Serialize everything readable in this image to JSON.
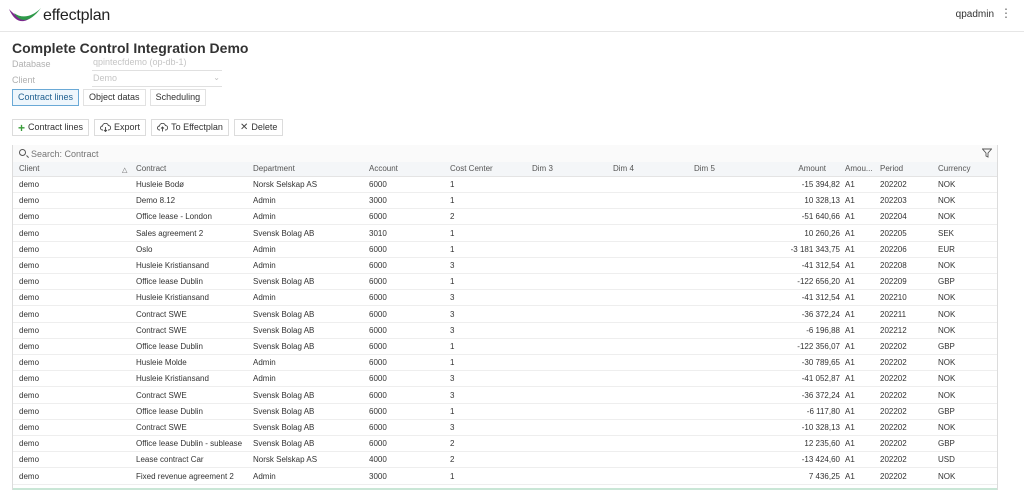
{
  "app": {
    "logo_text": "effectplan",
    "user": "qpadmin",
    "colors": {
      "accent": "#6aa9d6",
      "logo_purple": "#7a2a8c",
      "logo_green": "#2f9a4a"
    }
  },
  "page": {
    "title": "Complete Control Integration Demo",
    "database_label": "Database",
    "database_value": "qpintecfdemo (op-db-1)",
    "client_label": "Client",
    "client_value": "Demo"
  },
  "tabs": [
    {
      "label": "Contract lines",
      "active": true
    },
    {
      "label": "Object datas",
      "active": false
    },
    {
      "label": "Scheduling",
      "active": false
    }
  ],
  "toolbar": {
    "add_label": "Contract lines",
    "export_label": "Export",
    "to_effectplan_label": "To Effectplan",
    "delete_label": "Delete"
  },
  "grid": {
    "search_placeholder": "Search: Contract",
    "columns": [
      "Client",
      "Contract",
      "Department",
      "Account",
      "Cost Center",
      "Dim 3",
      "Dim 4",
      "Dim 5",
      "Amount",
      "Amou...",
      "Period",
      "Currency"
    ],
    "rows": [
      [
        "demo",
        "Husleie Bodø",
        "Norsk Selskap AS",
        "6000",
        "1",
        "",
        "",
        "",
        "-15 394,82",
        "A1",
        "202202",
        "NOK"
      ],
      [
        "demo",
        "Demo 8.12",
        "Admin",
        "3000",
        "1",
        "",
        "",
        "",
        "10 328,13",
        "A1",
        "202203",
        "NOK"
      ],
      [
        "demo",
        "Office lease - London",
        "Admin",
        "6000",
        "2",
        "",
        "",
        "",
        "-51 640,66",
        "A1",
        "202204",
        "NOK"
      ],
      [
        "demo",
        "Sales agreement 2",
        "Svensk Bolag AB",
        "3010",
        "1",
        "",
        "",
        "",
        "10 260,26",
        "A1",
        "202205",
        "SEK"
      ],
      [
        "demo",
        "Oslo",
        "Admin",
        "6000",
        "1",
        "",
        "",
        "",
        "-3 181 343,75",
        "A1",
        "202206",
        "EUR"
      ],
      [
        "demo",
        "Husleie Kristiansand",
        "Admin",
        "6000",
        "3",
        "",
        "",
        "",
        "-41 312,54",
        "A1",
        "202208",
        "NOK"
      ],
      [
        "demo",
        "Office lease Dublin",
        "Svensk Bolag AB",
        "6000",
        "1",
        "",
        "",
        "",
        "-122 656,20",
        "A1",
        "202209",
        "GBP"
      ],
      [
        "demo",
        "Husleie Kristiansand",
        "Admin",
        "6000",
        "3",
        "",
        "",
        "",
        "-41 312,54",
        "A1",
        "202210",
        "NOK"
      ],
      [
        "demo",
        "Contract SWE",
        "Svensk Bolag AB",
        "6000",
        "3",
        "",
        "",
        "",
        "-36 372,24",
        "A1",
        "202211",
        "NOK"
      ],
      [
        "demo",
        "Contract SWE",
        "Svensk Bolag AB",
        "6000",
        "3",
        "",
        "",
        "",
        "-6 196,88",
        "A1",
        "202212",
        "NOK"
      ],
      [
        "demo",
        "Office lease Dublin",
        "Svensk Bolag AB",
        "6000",
        "1",
        "",
        "",
        "",
        "-122 356,07",
        "A1",
        "202202",
        "GBP"
      ],
      [
        "demo",
        "Husleie Molde",
        "Admin",
        "6000",
        "1",
        "",
        "",
        "",
        "-30 789,65",
        "A1",
        "202202",
        "NOK"
      ],
      [
        "demo",
        "Husleie Kristiansand",
        "Admin",
        "6000",
        "3",
        "",
        "",
        "",
        "-41 052,87",
        "A1",
        "202202",
        "NOK"
      ],
      [
        "demo",
        "Contract SWE",
        "Svensk Bolag AB",
        "6000",
        "3",
        "",
        "",
        "",
        "-36 372,24",
        "A1",
        "202202",
        "NOK"
      ],
      [
        "demo",
        "Office lease Dublin",
        "Svensk Bolag AB",
        "6000",
        "1",
        "",
        "",
        "",
        "-6 117,80",
        "A1",
        "202202",
        "GBP"
      ],
      [
        "demo",
        "Contract SWE",
        "Svensk Bolag AB",
        "6000",
        "3",
        "",
        "",
        "",
        "-10 328,13",
        "A1",
        "202202",
        "NOK"
      ],
      [
        "demo",
        "Office lease Dublin - sublease",
        "Svensk Bolag AB",
        "6000",
        "2",
        "",
        "",
        "",
        "12 235,60",
        "A1",
        "202202",
        "GBP"
      ],
      [
        "demo",
        "Lease contract Car",
        "Norsk Selskap AS",
        "4000",
        "2",
        "",
        "",
        "",
        "-13 424,60",
        "A1",
        "202202",
        "USD"
      ],
      [
        "demo",
        "Fixed revenue agreement 2",
        "Admin",
        "3000",
        "1",
        "",
        "",
        "",
        "7 436,25",
        "A1",
        "202202",
        "NOK"
      ]
    ]
  }
}
